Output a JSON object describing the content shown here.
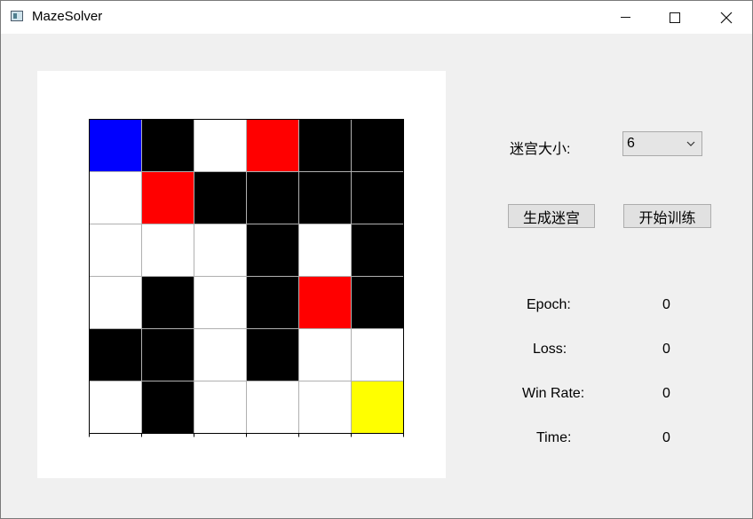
{
  "window": {
    "title": "MazeSolver",
    "controls": {
      "minimize": "minimize",
      "maximize": "maximize",
      "close": "close"
    }
  },
  "maze": {
    "size": 6,
    "colors": {
      "0": "#ffffff",
      "1": "#000000",
      "2": "#0000ff",
      "3": "#ff0000",
      "4": "#ffff00"
    },
    "legend_codes": {
      "free": 0,
      "wall": 1,
      "agent": 2,
      "red": 3,
      "goal": 4
    },
    "cells": [
      [
        2,
        1,
        0,
        3,
        1,
        1
      ],
      [
        0,
        3,
        1,
        1,
        1,
        1
      ],
      [
        0,
        0,
        0,
        1,
        0,
        1
      ],
      [
        0,
        1,
        0,
        1,
        3,
        1
      ],
      [
        1,
        1,
        0,
        1,
        0,
        0
      ],
      [
        0,
        1,
        0,
        0,
        0,
        4
      ]
    ]
  },
  "controls": {
    "maze_size_label": "迷宫大小:",
    "maze_size_value": "6",
    "generate_button": "生成迷宫",
    "train_button": "开始训练"
  },
  "stats": {
    "epoch_label": "Epoch:",
    "epoch_value": "0",
    "loss_label": "Loss:",
    "loss_value": "0",
    "winrate_label": "Win Rate:",
    "winrate_value": "0",
    "time_label": "Time:",
    "time_value": "0"
  }
}
